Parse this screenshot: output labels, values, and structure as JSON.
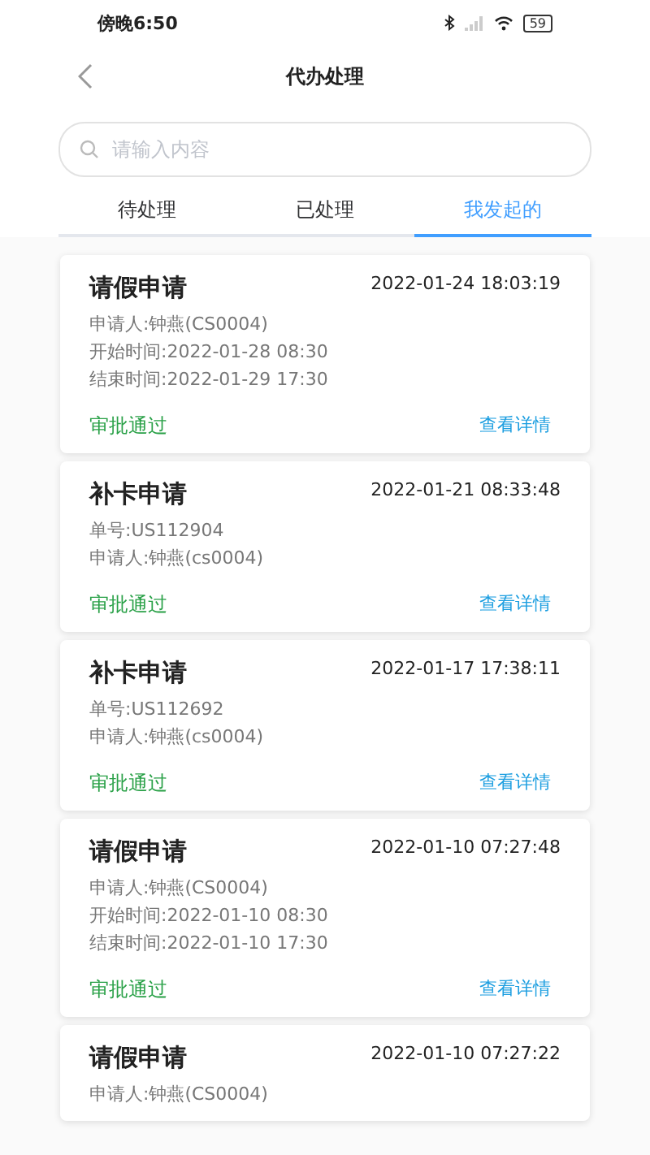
{
  "status_bar": {
    "time": "傍晚6:50",
    "battery": "59"
  },
  "header": {
    "title": "代办处理"
  },
  "search": {
    "placeholder": "请输入内容"
  },
  "tabs": [
    {
      "label": "待处理",
      "selected": false
    },
    {
      "label": "已处理",
      "selected": false
    },
    {
      "label": "我发起的",
      "selected": true
    }
  ],
  "cards": [
    {
      "title": "请假申请",
      "time": "2022-01-24 18:03:19",
      "details": [
        "申请人:钟燕(CS0004)",
        "开始时间:2022-01-28 08:30",
        "结束时间:2022-01-29 17:30"
      ],
      "status": "审批通过",
      "link": "查看详情"
    },
    {
      "title": "补卡申请",
      "time": "2022-01-21 08:33:48",
      "details": [
        "单号:US112904",
        "申请人:钟燕(cs0004)"
      ],
      "status": "审批通过",
      "link": "查看详情"
    },
    {
      "title": "补卡申请",
      "time": "2022-01-17 17:38:11",
      "details": [
        "单号:US112692",
        "申请人:钟燕(cs0004)"
      ],
      "status": "审批通过",
      "link": "查看详情"
    },
    {
      "title": "请假申请",
      "time": "2022-01-10 07:27:48",
      "details": [
        "申请人:钟燕(CS0004)",
        "开始时间:2022-01-10 08:30",
        "结束时间:2022-01-10 17:30"
      ],
      "status": "审批通过",
      "link": "查看详情"
    },
    {
      "title": "请假申请",
      "time": "2022-01-10 07:27:22",
      "details": [
        "申请人:钟燕(CS0004)"
      ]
    }
  ]
}
